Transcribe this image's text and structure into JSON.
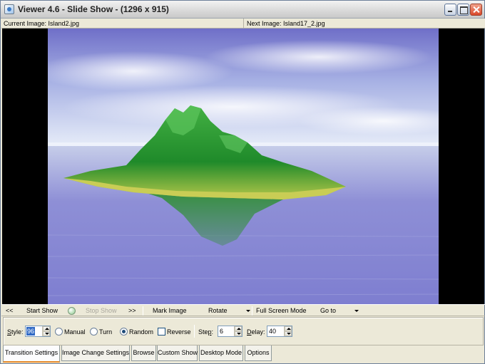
{
  "window": {
    "title": "Viewer 4.6 - Slide Show - (1296 x 915)"
  },
  "info": {
    "current_image": "Current Image: Island2.jpg",
    "next_image": "Next Image: Island17_2.jpg"
  },
  "controls": {
    "prev": "<<",
    "start_show": "Start Show",
    "stop_show": "Stop Show",
    "next": ">>",
    "mark_image": "Mark Image",
    "rotate": "Rotate",
    "full_screen": "Full Screen Mode",
    "go_to": "Go to"
  },
  "settings": {
    "style_label_u": "S",
    "style_label_rest": "tyle:",
    "style_value": "96",
    "manual": "Manual",
    "turn": "Turn",
    "random": "Random",
    "reverse": "Reverse",
    "selected_mode": "Random",
    "reverse_checked": false,
    "step_label_pre": "Ste",
    "step_label_u": "p",
    "step_label_post": ":",
    "step_value": "6",
    "delay_label_u": "D",
    "delay_label_rest": "elay:",
    "delay_value": "40"
  },
  "tabs": [
    {
      "label": "Transition Settings",
      "active": true
    },
    {
      "label": "Image Change Settings",
      "active": false
    },
    {
      "label": "Browse",
      "active": false
    },
    {
      "label": "Custom Show",
      "active": false
    },
    {
      "label": "Desktop Mode",
      "active": false
    },
    {
      "label": "Options",
      "active": false
    }
  ]
}
